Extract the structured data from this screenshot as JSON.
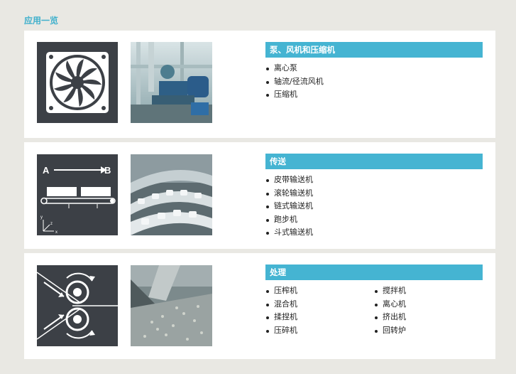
{
  "page": {
    "title": "应用一览"
  },
  "sections": [
    {
      "header": "泵、风机和压缩机",
      "icon": "fan-icon",
      "photo": "pump-room-photo",
      "items": [
        "离心泵",
        "轴流/径流风机",
        "压缩机"
      ]
    },
    {
      "header": "传送",
      "icon": "conveyor-icon",
      "photo": "bottle-conveyor-photo",
      "icon_labels": {
        "from": "A",
        "to": "B",
        "axis_y": "y",
        "axis_z": "z",
        "axis_x": "x"
      },
      "items": [
        "皮带输送机",
        "滚轮输送机",
        "链式输送机",
        "跑步机",
        "斗式输送机"
      ]
    },
    {
      "header": "处理",
      "icon": "rollers-icon",
      "photo": "granulate-photo",
      "columns": [
        [
          "压榨机",
          "混合机",
          "揉捏机",
          "压碎机"
        ],
        [
          "搅拌机",
          "离心机",
          "挤出机",
          "回转炉"
        ]
      ]
    }
  ]
}
